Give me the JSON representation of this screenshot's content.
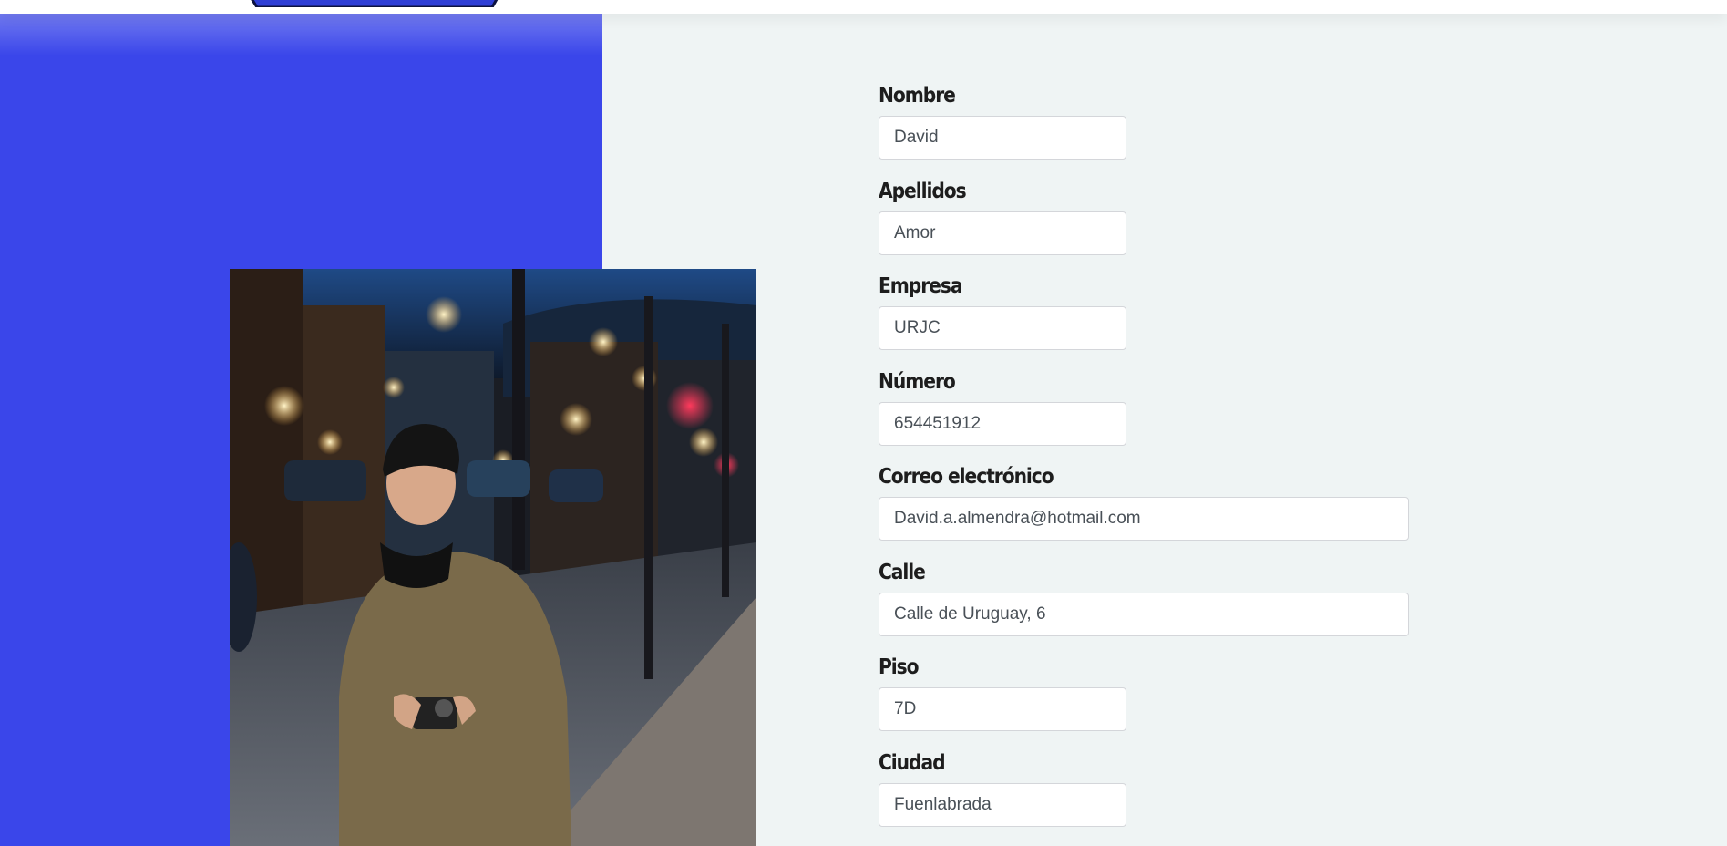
{
  "form": {
    "fields": [
      {
        "label": "Nombre",
        "value": "David"
      },
      {
        "label": "Apellidos",
        "value": "Amor"
      },
      {
        "label": "Empresa",
        "value": "URJC"
      },
      {
        "label": "Número",
        "value": "654451912"
      },
      {
        "label": "Correo electrónico",
        "value": "David.a.almendra@hotmail.com"
      },
      {
        "label": "Calle",
        "value": "Calle de Uruguay, 6"
      },
      {
        "label": "Piso",
        "value": "7D"
      },
      {
        "label": "Ciudad",
        "value": "Fuenlabrada"
      }
    ]
  },
  "colors": {
    "accent_panel": "#3a46ea",
    "page_background": "#eff4f4"
  },
  "images": {
    "profile_photo": "man-with-camera-on-night-street-photo",
    "logo": "site-logo"
  }
}
